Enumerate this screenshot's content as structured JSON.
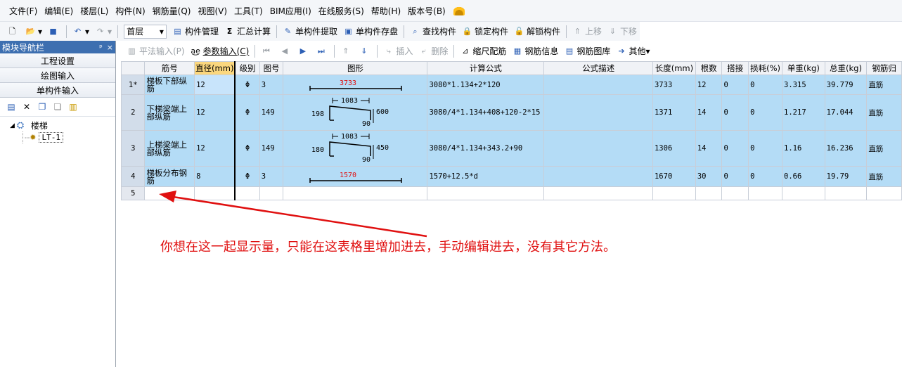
{
  "menu": [
    "文件(F)",
    "编辑(E)",
    "楼层(L)",
    "构件(N)",
    "钢筋量(Q)",
    "视图(V)",
    "工具(T)",
    "BIM应用(I)",
    "在线服务(S)",
    "帮助(H)",
    "版本号(B)"
  ],
  "toolbar1": {
    "floor_value": "首层",
    "component_manage": "构件管理",
    "sum_calc": "汇总计算",
    "single_extract": "单构件提取",
    "single_save": "单构件存盘",
    "find_component": "查找构件",
    "lock_component": "锁定构件",
    "unlock_component": "解锁构件",
    "move_up": "上移",
    "move_down": "下移"
  },
  "left_panel": {
    "title": "模块导航栏",
    "pin": "ᵖ",
    "close": "×",
    "sections": [
      "工程设置",
      "绘图输入",
      "单构件输入"
    ],
    "tree_root": "楼梯",
    "tree_leaf": "LT-1"
  },
  "toolbar2": {
    "flat_input": "平法输入(P)",
    "param_input": "参数输入(C)",
    "insert": "插入",
    "delete": "删除",
    "scale_rebar": "缩尺配筋",
    "rebar_info": "钢筋信息",
    "rebar_library": "钢筋图库",
    "other": "其他"
  },
  "grid": {
    "headers": [
      "",
      "筋号",
      "直径(mm)",
      "级别",
      "图号",
      "图形",
      "计算公式",
      "公式描述",
      "长度(mm)",
      "根数",
      "搭接",
      "损耗(%)",
      "单重(kg)",
      "总重(kg)",
      "钢筋归"
    ],
    "rows": [
      {
        "num": "1*",
        "name": "梯板下部纵筋",
        "diameter": "12",
        "grade": "Φ",
        "fig": "3",
        "shape": {
          "type": "straight",
          "length": "3733"
        },
        "formula": "3080*1.134+2*120",
        "desc": "",
        "length": "3733",
        "count": "12",
        "lap": "0",
        "loss": "0",
        "unit_weight": "3.315",
        "total_weight": "39.779",
        "category": "直筋"
      },
      {
        "num": "2",
        "name": "下梯梁端上部纵筋",
        "diameter": "12",
        "grade": "Φ",
        "fig": "149",
        "shape": {
          "type": "bent",
          "top": "1083",
          "left": "198",
          "right": "600",
          "bottom": "90"
        },
        "formula": "3080/4*1.134+408+120-2*15",
        "desc": "",
        "length": "1371",
        "count": "14",
        "lap": "0",
        "loss": "0",
        "unit_weight": "1.217",
        "total_weight": "17.044",
        "category": "直筋"
      },
      {
        "num": "3",
        "name": "上梯梁端上部纵筋",
        "diameter": "12",
        "grade": "Φ",
        "fig": "149",
        "shape": {
          "type": "bent",
          "top": "1083",
          "left": "180",
          "right": "450",
          "bottom": "90"
        },
        "formula": "3080/4*1.134+343.2+90",
        "desc": "",
        "length": "1306",
        "count": "14",
        "lap": "0",
        "loss": "0",
        "unit_weight": "1.16",
        "total_weight": "16.236",
        "category": "直筋"
      },
      {
        "num": "4",
        "name": "梯板分布钢筋",
        "diameter": "8",
        "grade": "Φ",
        "fig": "3",
        "shape": {
          "type": "straight",
          "length": "1570"
        },
        "formula": "1570+12.5*d",
        "desc": "",
        "length": "1670",
        "count": "30",
        "lap": "0",
        "loss": "0",
        "unit_weight": "0.66",
        "total_weight": "19.79",
        "category": "直筋"
      }
    ],
    "empty_row_num": "5"
  },
  "annotation": "你想在这一起显示量，只能在这表格里增加进去，手动编辑进去，没有其它方法。",
  "colors": {
    "selected_row": "#b4dcf6",
    "active_header": "#fbd77e",
    "annotation": "#e01010",
    "nav_title": "#3d6fb0"
  }
}
